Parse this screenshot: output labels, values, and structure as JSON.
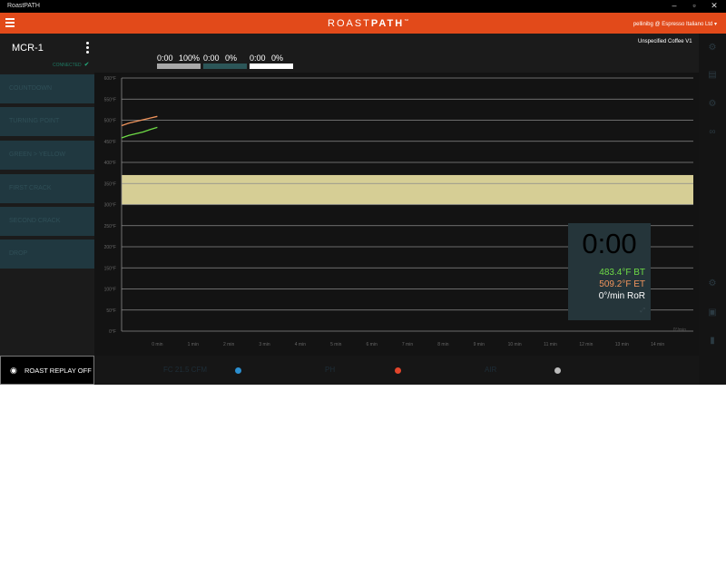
{
  "window": {
    "title": "RoastPATH"
  },
  "appbar": {
    "brand_light": "ROAST",
    "brand_bold": "PATH",
    "brand_mark": "™",
    "user": "pellinibg @ Espresso Italiano Ltd"
  },
  "device": {
    "name": "MCR-1",
    "status": "CONNECTED"
  },
  "events": [
    "COUNTDOWN",
    "TURNING POINT",
    "GREEN > YELLOW",
    "FIRST CRACK",
    "SECOND CRACK",
    "DROP"
  ],
  "replay": {
    "label": "ROAST REPLAY OFF"
  },
  "coffee": {
    "name": "Unspecified Coffee V1"
  },
  "progress": [
    {
      "time": "0:00",
      "pct": "100%",
      "color": "#a8a8a8",
      "fill": 1.0
    },
    {
      "time": "0:00",
      "pct": "0%",
      "color": "#2c5658",
      "fill": 0.0
    },
    {
      "time": "0:00",
      "pct": "0%",
      "color": "#ffffff",
      "fill": 0.0
    }
  ],
  "readout": {
    "time": "0:00",
    "bt": "483.4°F BT",
    "et": "509.2°F ET",
    "ror": "0°/min RoR",
    "expand": "⤢"
  },
  "bottom": [
    {
      "label": "FC  21.5 CFM",
      "color": "#2b8fd0"
    },
    {
      "label": "PH",
      "color": "#e2452b"
    },
    {
      "label": "AIR",
      "color": "#bbbbbb"
    }
  ],
  "colors": {
    "accent": "#e24a1a",
    "bt": "#6edb46",
    "et": "#f0945c",
    "band": "#d6ce95",
    "event_bg": "#203840"
  },
  "chart_data": {
    "type": "line",
    "ylim": [
      0,
      600
    ],
    "xlim": [
      -1,
      15
    ],
    "y_ticks": [
      "600°F",
      "550°F",
      "500°F",
      "450°F",
      "400°F",
      "350°F",
      "300°F",
      "250°F",
      "200°F",
      "150°F",
      "100°F",
      "50°F",
      "0°F"
    ],
    "y_tick_values": [
      600,
      550,
      500,
      450,
      400,
      350,
      300,
      250,
      200,
      150,
      100,
      50,
      0
    ],
    "x_ticks": [
      "0 min",
      "1 min",
      "2 min",
      "3 min",
      "4 min",
      "5 min",
      "6 min",
      "7 min",
      "8 min",
      "9 min",
      "10 min",
      "11 min",
      "12 min",
      "13 min",
      "14 min"
    ],
    "x_tick_values": [
      0,
      1,
      2,
      3,
      4,
      5,
      6,
      7,
      8,
      9,
      10,
      11,
      12,
      13,
      14
    ],
    "x_unit_label": "0°/min",
    "band": [
      300,
      370
    ],
    "series": [
      {
        "name": "ET",
        "color": "#f0945c",
        "x": [
          -1,
          -0.8,
          -0.6,
          -0.4,
          -0.2,
          0
        ],
        "y": [
          487,
          493,
          497,
          501,
          505,
          509
        ]
      },
      {
        "name": "BT",
        "color": "#6edb46",
        "x": [
          -1,
          -0.8,
          -0.6,
          -0.4,
          -0.2,
          0
        ],
        "y": [
          458,
          464,
          468,
          472,
          478,
          483
        ]
      }
    ]
  }
}
